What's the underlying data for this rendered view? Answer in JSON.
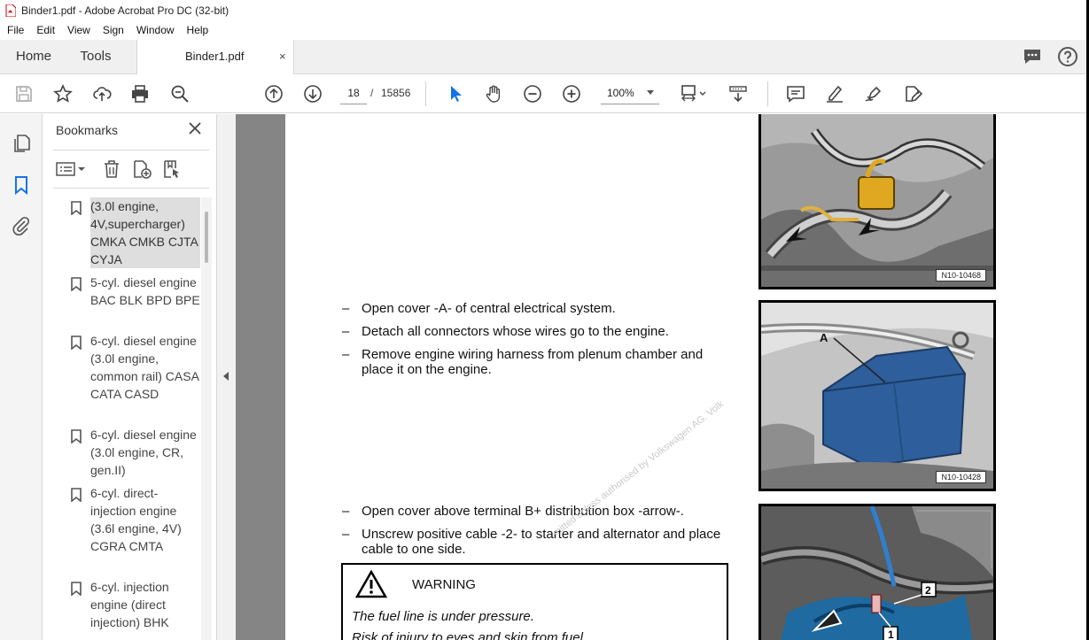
{
  "window": {
    "title": "Binder1.pdf - Adobe Acrobat Pro DC (32-bit)"
  },
  "menu": [
    "File",
    "Edit",
    "View",
    "Sign",
    "Window",
    "Help"
  ],
  "tabs": {
    "home": "Home",
    "tools": "Tools",
    "document": "Binder1.pdf",
    "close_glyph": "×"
  },
  "toolbar": {
    "current_page": "18",
    "page_separator": "/",
    "total_pages": "15856",
    "zoom": "100%"
  },
  "bookmarks": {
    "title": "Bookmarks",
    "items": [
      {
        "label": "(3.0l engine, 4V,supercharger) CMKA CMKB CJTA CYJA",
        "selected": true
      },
      {
        "label": "5-cyl. diesel engine BAC BLK BPD BPE",
        "selected": false
      },
      {
        "label": "6-cyl. diesel engine (3.0l engine, common rail) CASA CATA CASD",
        "selected": false
      },
      {
        "label": "6-cyl. diesel engine (3.0l engine, CR, gen.II)",
        "selected": false
      },
      {
        "label": "6-cyl. direct-injection engine (3.6l engine, 4V) CGRA CMTA",
        "selected": false
      },
      {
        "label": "6-cyl. injection engine (direct injection) BHK",
        "selected": false
      }
    ]
  },
  "document": {
    "steps_group1": [
      "Open cover -A- of central electrical system.",
      "Detach all connectors whose wires go to the engine.",
      "Remove engine wiring harness from plenum chamber and place it on the engine."
    ],
    "steps_group2": [
      "Open cover above terminal B+ distribution box -arrow-.",
      "Unscrew positive cable -2- to starter and alternator and place cable to one side."
    ],
    "dash": "–",
    "figures": [
      {
        "label": "N10-10468"
      },
      {
        "label": "N10-10428",
        "callout": "A"
      },
      {
        "callouts": [
          "2",
          "1"
        ]
      }
    ],
    "warning": {
      "title": "WARNING",
      "lines": [
        "The fuel line is under pressure.",
        "Risk of injury to eyes and skin from fuel."
      ]
    },
    "watermark": "mitted unless authorised by Volkswagen AG. Volk"
  },
  "colors": {
    "accent_blue": "#1473e6",
    "panel_gray": "#858585",
    "cover_blue": "#2e5f9c"
  }
}
